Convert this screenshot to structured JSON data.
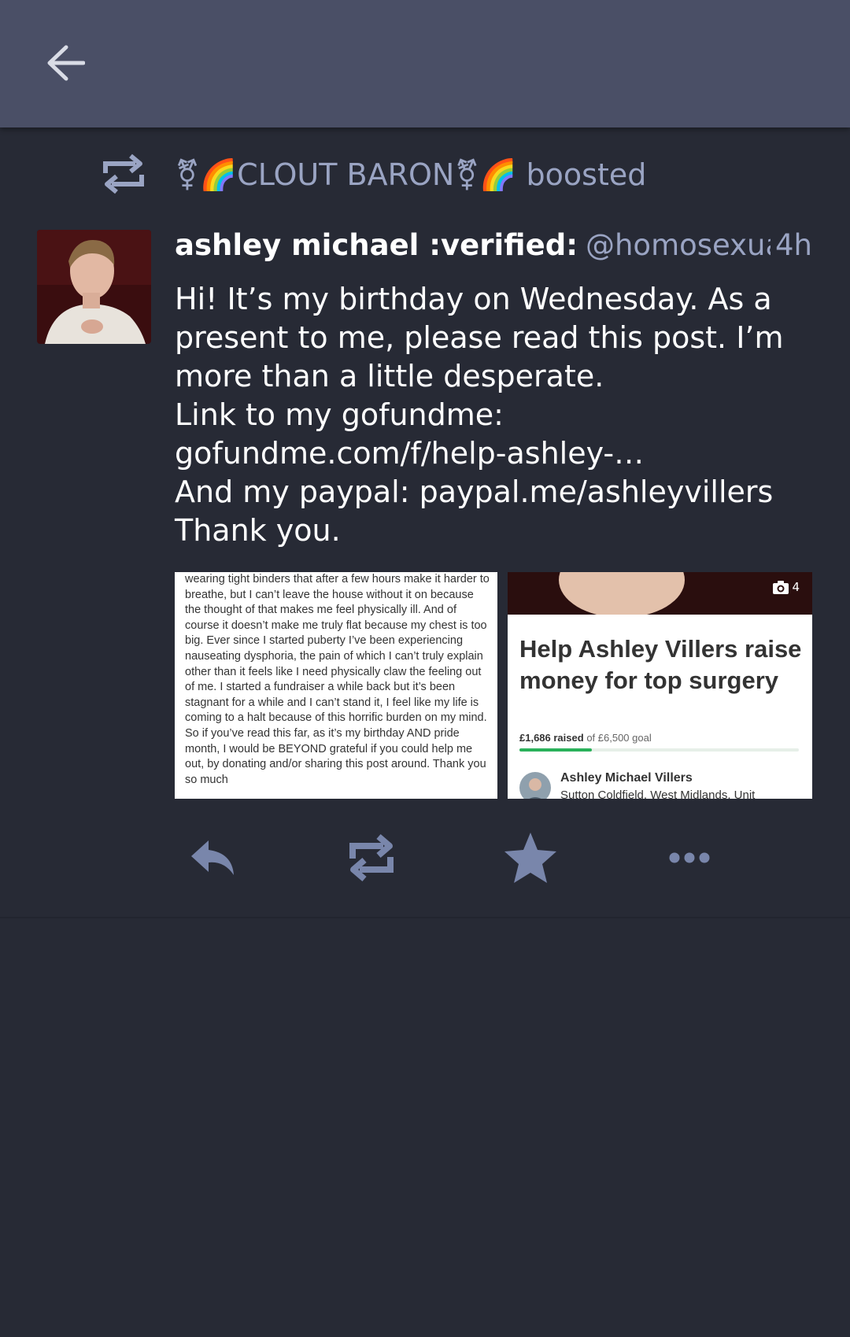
{
  "boost": {
    "text": "⚧🌈CLOUT BARON⚧🌈 boosted"
  },
  "post": {
    "display_name": "ashley michael :verified:",
    "handle": "@homosexua…",
    "time": "4h",
    "content": {
      "line1": "Hi! It’s my birthday on Wednesday. As a present to me, please read this post. I’m more than a little desperate.",
      "gofundme_prefix": "Link to my gofundme: ",
      "gofundme_link": "gofundme.com/f/help-ashley-…",
      "paypal_prefix": "And my paypal: ",
      "paypal_link": "paypal.me/ashleyvillers",
      "closing": "Thank you."
    },
    "media": {
      "photo_count": "4",
      "left_text": "wearing tight binders that after a few hours make it harder to breathe, but I can’t leave the house without it on because the thought of that makes me feel physically ill. And of course it doesn’t make me truly flat because my chest is too big. Ever since I started puberty I’ve been experiencing nauseating dysphoria, the pain of which I can’t truly explain other than it feels like I need physically claw the feeling out of me. I started a fundraiser a while back but it’s been stagnant for a while and I can’t stand it, I feel like my life is coming to a halt because of this horrific burden on my mind. So if you’ve read this far, as it’s my birthday AND pride month, I would be BEYOND grateful if you could help me out, by donating and/or sharing this post around. Thank you so much",
      "fundraiser": {
        "title": "Help Ashley Villers raise money for top surgery",
        "raised": "£1,686 raised",
        "goal": "of £6,500 goal",
        "progress": 0.26,
        "organizer": "Ashley Michael Villers",
        "location": "Sutton Coldfield, West Midlands, Unit"
      }
    }
  },
  "colors": {
    "topbar": "#4a4f66",
    "background": "#272a35",
    "muted": "#9aa4c3",
    "action_icon": "#7986ab"
  }
}
